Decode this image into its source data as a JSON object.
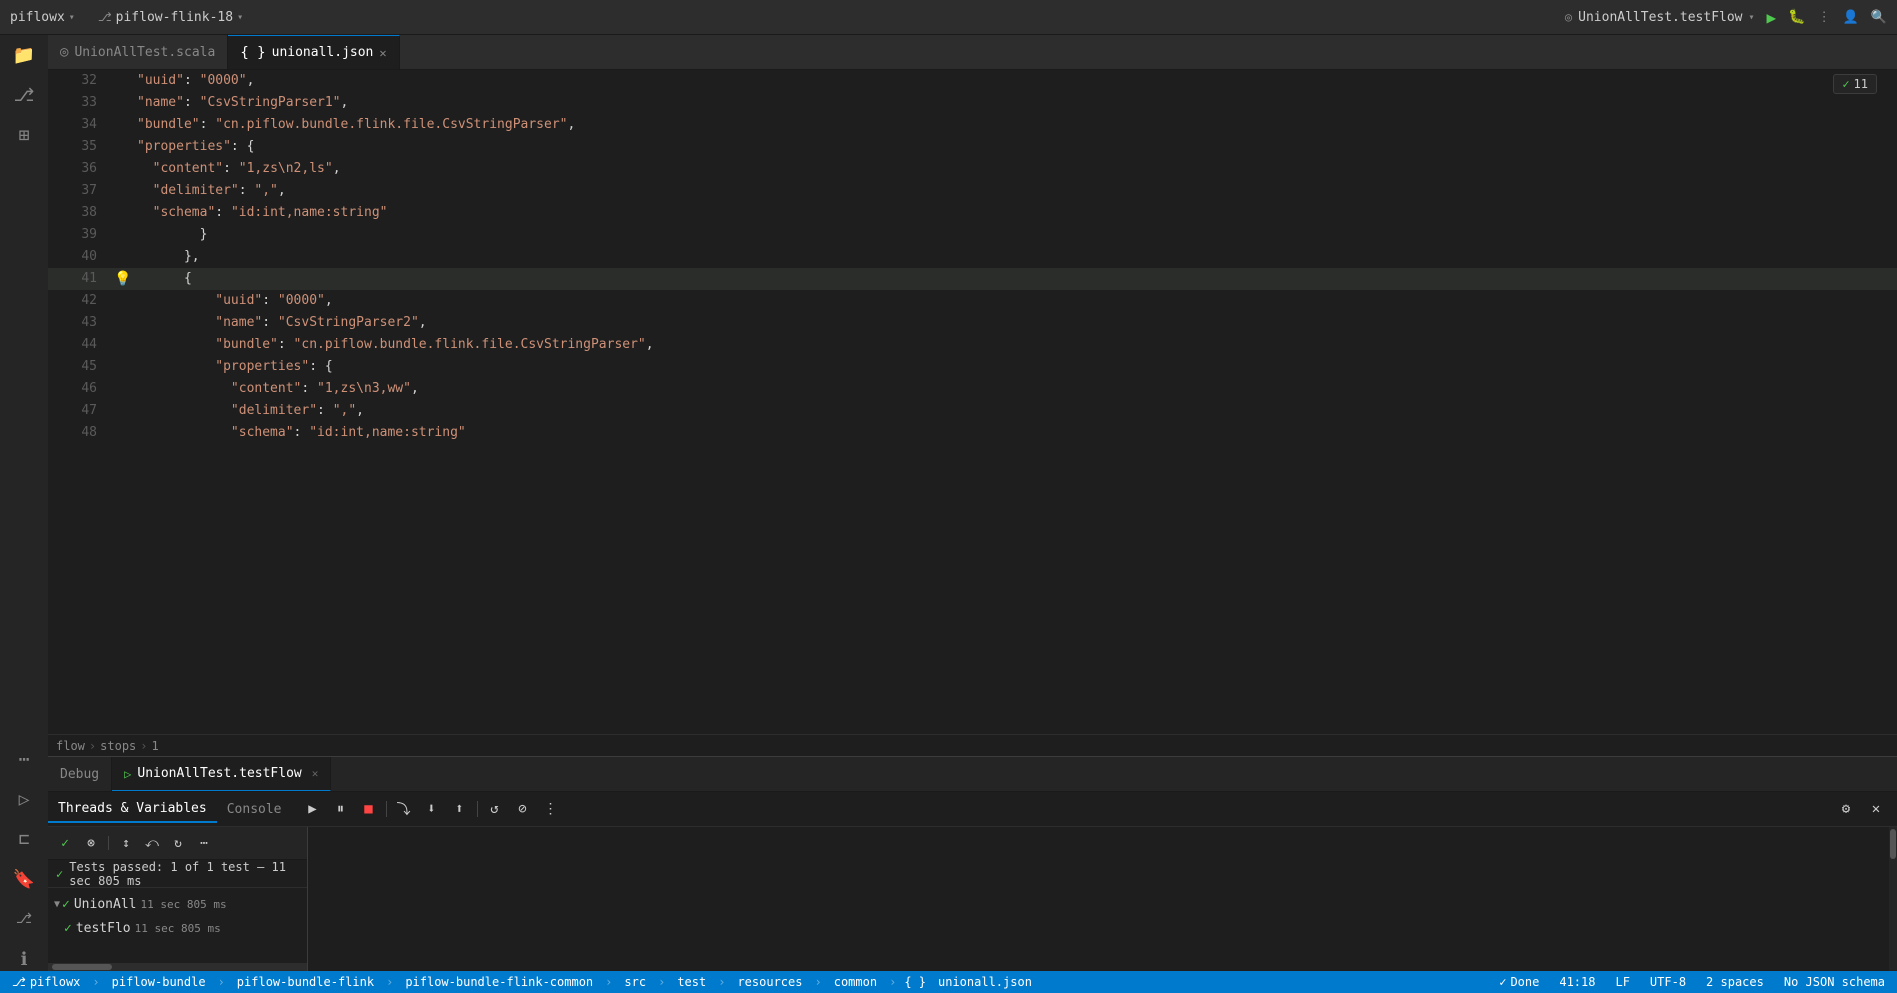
{
  "titleBar": {
    "project": "piflowx",
    "branch": "piflow-flink-18",
    "runConfig": "UnionAllTest.testFlow",
    "chevron": "▾"
  },
  "tabs": [
    {
      "id": "scala",
      "icon": "◎",
      "label": "UnionAllTest.scala",
      "closable": false,
      "active": false
    },
    {
      "id": "json",
      "icon": "{ }",
      "label": "unionall.json",
      "closable": true,
      "active": true
    }
  ],
  "codeLines": [
    {
      "num": 32,
      "content": "          \"uuid\": \"0000\","
    },
    {
      "num": 33,
      "content": "          \"name\": \"CsvStringParser1\","
    },
    {
      "num": 34,
      "content": "          \"bundle\": \"cn.piflow.bundle.flink.file.CsvStringParser\","
    },
    {
      "num": 35,
      "content": "          \"properties\": {"
    },
    {
      "num": 36,
      "content": "            \"content\": \"1,zs\\n2,ls\","
    },
    {
      "num": 37,
      "content": "            \"delimiter\": \",\","
    },
    {
      "num": 38,
      "content": "            \"schema\": \"id:int,name:string\""
    },
    {
      "num": 39,
      "content": "          }"
    },
    {
      "num": 40,
      "content": "        },"
    },
    {
      "num": 41,
      "content": "        {",
      "bulb": true,
      "highlight": true
    },
    {
      "num": 42,
      "content": "          \"uuid\": \"0000\","
    },
    {
      "num": 43,
      "content": "          \"name\": \"CsvStringParser2\","
    },
    {
      "num": 44,
      "content": "          \"bundle\": \"cn.piflow.bundle.flink.file.CsvStringParser\","
    },
    {
      "num": 45,
      "content": "          \"properties\": {"
    },
    {
      "num": 46,
      "content": "            \"content\": \"1,zs\\n3,ww\","
    },
    {
      "num": 47,
      "content": "            \"delimiter\": \",\","
    },
    {
      "num": 48,
      "content": "            \"schema\": \"id:int,name:string\""
    }
  ],
  "breadcrumb": {
    "items": [
      "flow",
      "stops",
      "1"
    ]
  },
  "debugPanel": {
    "tabs": [
      {
        "id": "debug",
        "label": "Debug",
        "active": false
      },
      {
        "id": "unionall",
        "icon": "▷",
        "label": "UnionAllTest.testFlow",
        "active": true,
        "closable": true
      }
    ],
    "subTabs": [
      {
        "id": "threads",
        "label": "Threads & Variables",
        "active": true
      },
      {
        "id": "console",
        "label": "Console",
        "active": false
      }
    ],
    "toolbar": {
      "btns": [
        {
          "id": "resume",
          "icon": "▶",
          "label": "Resume"
        },
        {
          "id": "pause",
          "icon": "⏸",
          "label": "Pause"
        },
        {
          "id": "stop",
          "icon": "■",
          "label": "Stop"
        },
        {
          "id": "step-over",
          "icon": "⤵",
          "label": "Step Over"
        },
        {
          "id": "step-into",
          "icon": "⬇",
          "label": "Step Into"
        },
        {
          "id": "step-out",
          "icon": "⬆",
          "label": "Step Out"
        },
        {
          "id": "rerun",
          "icon": "↺",
          "label": "Rerun"
        },
        {
          "id": "mute",
          "icon": "⊘",
          "label": "Mute"
        },
        {
          "id": "more",
          "icon": "⋮",
          "label": "More"
        }
      ]
    },
    "testToolbar": {
      "btns": [
        {
          "id": "check",
          "icon": "✓",
          "label": "Check"
        },
        {
          "id": "stop-circle",
          "icon": "⊗",
          "label": "Stop"
        },
        {
          "id": "sort-az",
          "icon": "↕",
          "label": "Sort"
        },
        {
          "id": "collapse",
          "icon": "⇤",
          "label": "Collapse"
        },
        {
          "id": "restart",
          "icon": "↻",
          "label": "Restart"
        },
        {
          "id": "more2",
          "icon": "⋯",
          "label": "More"
        }
      ]
    },
    "testStatus": {
      "icon": "✓",
      "text": "Tests passed: 1 of 1 test – 11 sec 805 ms"
    },
    "testTree": [
      {
        "id": "union-all",
        "expand": "▼",
        "passIcon": "✓",
        "label": "UnionAll",
        "time": "11 sec 805 ms",
        "children": [
          {
            "id": "test-flow",
            "passIcon": "✓",
            "label": "testFlo",
            "time": "11 sec 805 ms"
          }
        ]
      }
    ]
  },
  "statusBar": {
    "leftItems": [
      {
        "id": "branch",
        "icon": "⎇",
        "label": "piflowx"
      },
      {
        "id": "project",
        "label": "piflow-bundle"
      },
      {
        "id": "sub1",
        "label": "piflow-bundle-flink"
      },
      {
        "id": "sub2",
        "label": "piflow-bundle-flink-common"
      },
      {
        "id": "src",
        "label": "src"
      },
      {
        "id": "test",
        "label": "test"
      },
      {
        "id": "resources",
        "label": "resources"
      },
      {
        "id": "common",
        "label": "common"
      },
      {
        "id": "file",
        "label": "unionall.json"
      }
    ],
    "rightItems": [
      {
        "id": "done",
        "icon": "✓",
        "label": "Done"
      },
      {
        "id": "position",
        "label": "41:18"
      },
      {
        "id": "eol",
        "label": "LF"
      },
      {
        "id": "encoding",
        "label": "UTF-8"
      },
      {
        "id": "indent",
        "label": "2 spaces"
      },
      {
        "id": "schema",
        "label": "No JSON schema"
      }
    ]
  },
  "editorInfo": {
    "lineCount": "11",
    "totalLines": "11"
  }
}
